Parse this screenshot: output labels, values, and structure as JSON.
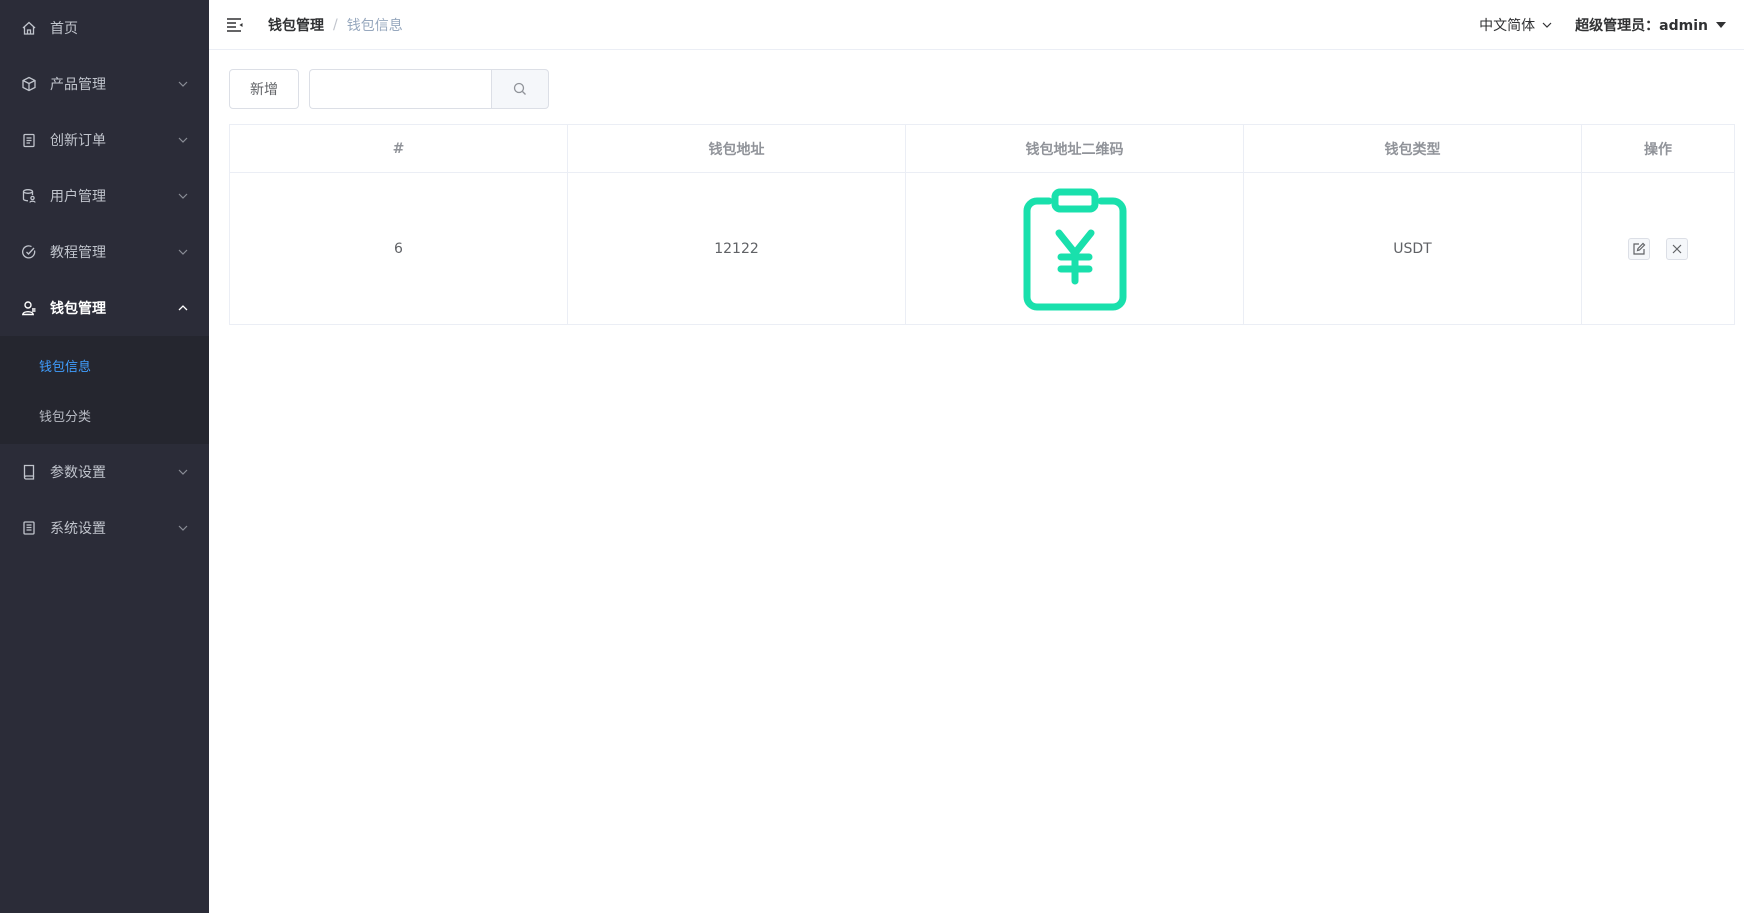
{
  "sidebar": {
    "items": [
      {
        "label": "首页",
        "icon": "home-icon"
      },
      {
        "label": "产品管理",
        "icon": "box-icon"
      },
      {
        "label": "创新订单",
        "icon": "clipboard-icon"
      },
      {
        "label": "用户管理",
        "icon": "database-user-icon"
      },
      {
        "label": "教程管理",
        "icon": "check-circle-icon"
      },
      {
        "label": "钱包管理",
        "icon": "user-icon",
        "expanded": true
      },
      {
        "label": "参数设置",
        "icon": "notebook-icon"
      },
      {
        "label": "系统设置",
        "icon": "document-icon"
      }
    ],
    "submenu": [
      {
        "label": "钱包信息",
        "active": true
      },
      {
        "label": "钱包分类",
        "active": false
      }
    ],
    "active_color": "#409eff",
    "background": "#2b2c38"
  },
  "header": {
    "breadcrumb": [
      "钱包管理",
      "钱包信息"
    ],
    "breadcrumb_separator": "/",
    "language": "中文简体",
    "user": "超级管理员：admin"
  },
  "toolbar": {
    "add_label": "新增",
    "search_value": "",
    "search_placeholder": ""
  },
  "table": {
    "columns": [
      "#",
      "钱包地址",
      "钱包地址二维码",
      "钱包类型",
      "操作"
    ],
    "rows": [
      {
        "id": "6",
        "address": "12122",
        "qr_icon": "clipboard-yen-icon",
        "type": "USDT"
      }
    ],
    "qr_color": "#19e0ac"
  }
}
